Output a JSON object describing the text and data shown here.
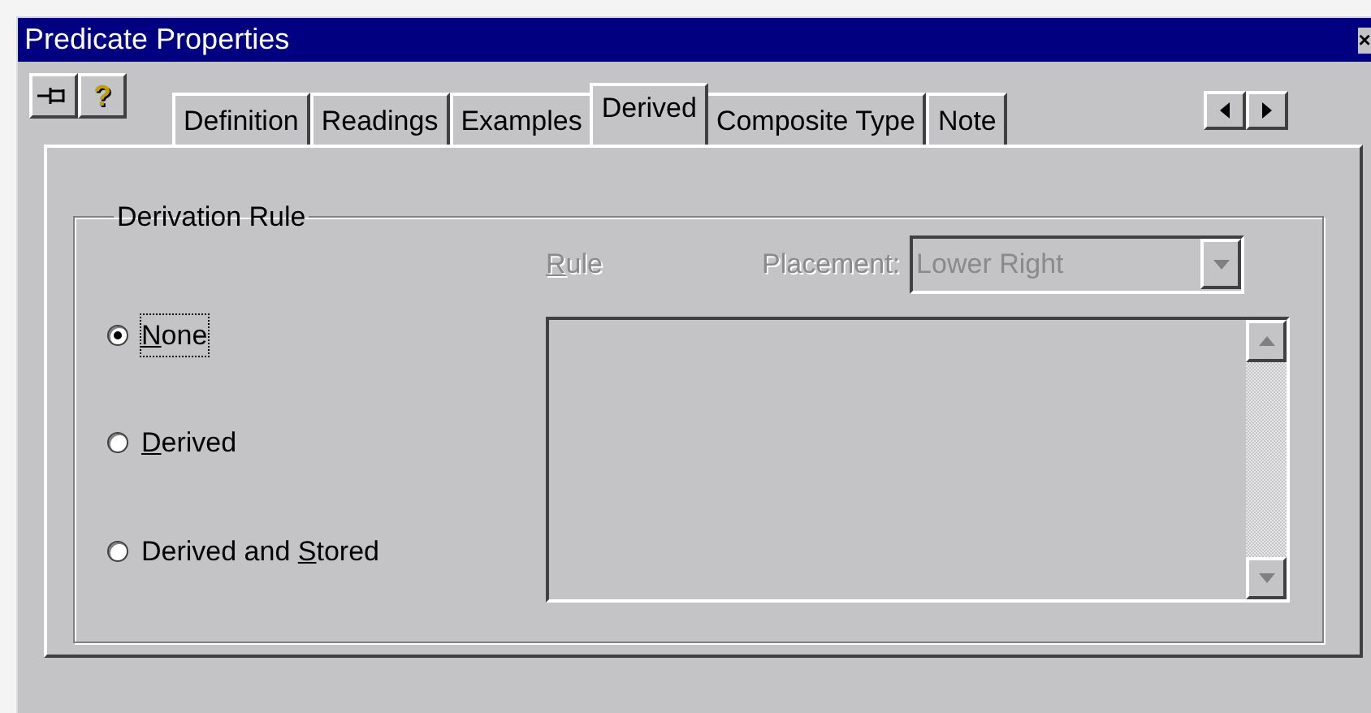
{
  "window": {
    "title": "Predicate Properties",
    "close": "×"
  },
  "toolbar": [
    {
      "kind": "pin"
    },
    {
      "kind": "help",
      "label": "?"
    }
  ],
  "tabs": [
    {
      "label": "Definition",
      "selected": false
    },
    {
      "label": "Readings",
      "selected": false
    },
    {
      "label": "Examples",
      "selected": false
    },
    {
      "label": "Derived",
      "selected": true
    },
    {
      "label": "Composite Type",
      "selected": false
    },
    {
      "label": "Note",
      "selected": false
    }
  ],
  "group": {
    "title": "Derivation Rule",
    "options": [
      {
        "key": "N",
        "after": "one",
        "selected": true
      },
      {
        "key": "D",
        "after": "erived",
        "selected": false
      },
      {
        "before": "Derived and ",
        "key": "S",
        "after": "tored",
        "selected": false
      }
    ],
    "rule_label": {
      "key": "R",
      "after": "ule",
      "disabled": true
    },
    "placement_label": {
      "text": "Placement:",
      "disabled": true
    },
    "placement": {
      "value": "Lower Right",
      "disabled": true
    },
    "rule_box": {
      "disabled": true
    }
  }
}
